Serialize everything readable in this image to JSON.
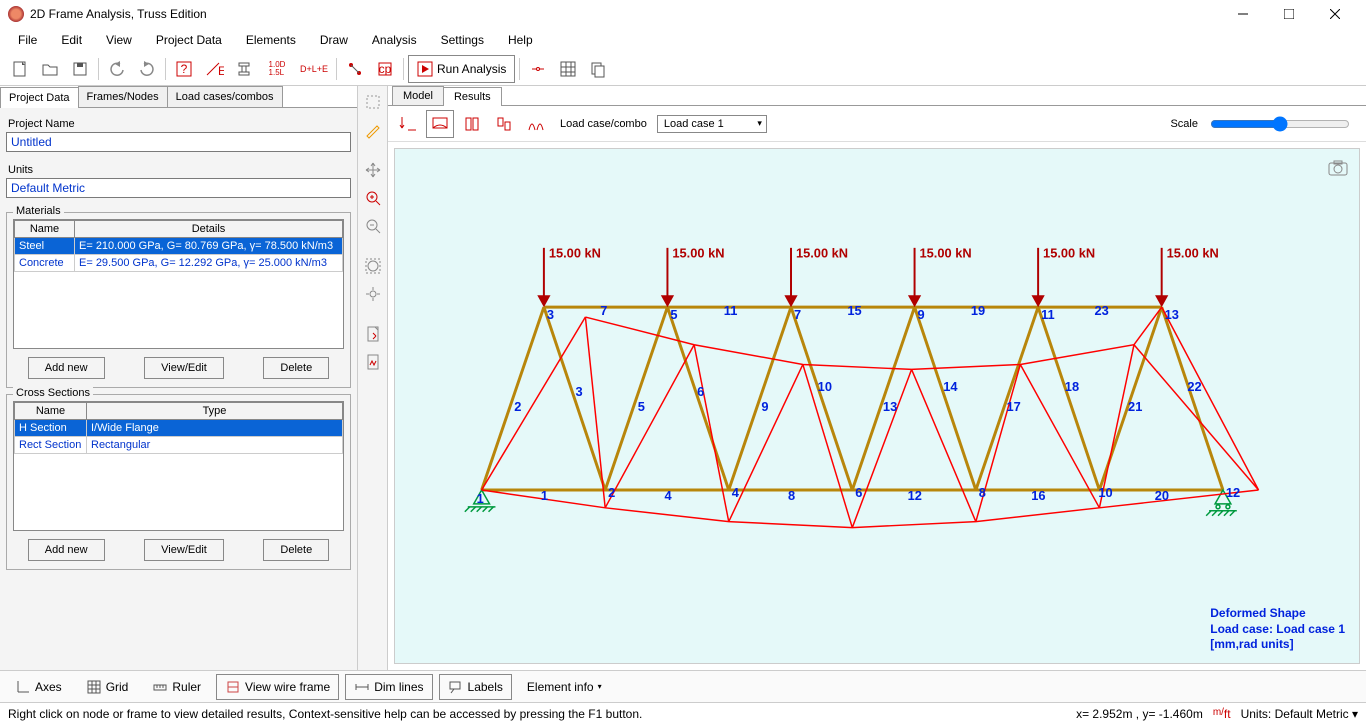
{
  "app": {
    "title": "2D Frame Analysis, Truss Edition"
  },
  "menu": {
    "items": [
      "File",
      "Edit",
      "View",
      "Project Data",
      "Elements",
      "Draw",
      "Analysis",
      "Settings",
      "Help"
    ]
  },
  "toolbar": {
    "run_label": "Run Analysis",
    "txt1": "1.0D\n1.5L",
    "txt2": "D+L+E"
  },
  "left_tabs": {
    "items": [
      "Project Data",
      "Frames/Nodes",
      "Load cases/combos"
    ],
    "active": 0
  },
  "project": {
    "name_label": "Project Name",
    "name_value": "Untitled",
    "units_label": "Units",
    "units_value": "Default Metric"
  },
  "materials": {
    "title": "Materials",
    "headers": [
      "Name",
      "Details"
    ],
    "rows": [
      {
        "name": "Steel",
        "details": "E= 210.000 GPa, G= 80.769 GPa, γ= 78.500 kN/m3",
        "sel": true
      },
      {
        "name": "Concrete",
        "details": "E= 29.500 GPa, G= 12.292 GPa, γ= 25.000 kN/m3",
        "sel": false
      }
    ]
  },
  "sections": {
    "title": "Cross Sections",
    "headers": [
      "Name",
      "Type"
    ],
    "rows": [
      {
        "name": "H Section",
        "type": "I/Wide Flange",
        "sel": true
      },
      {
        "name": "Rect Section",
        "type": "Rectangular",
        "sel": false
      }
    ]
  },
  "buttons": {
    "add": "Add new",
    "edit": "View/Edit",
    "del": "Delete"
  },
  "right_tabs": {
    "items": [
      "Model",
      "Results"
    ],
    "active": 1
  },
  "results_bar": {
    "lc_label": "Load case/combo",
    "lc_value": "Load case 1",
    "scale_label": "Scale"
  },
  "canvas": {
    "loads": [
      "15.00 kN",
      "15.00 kN",
      "15.00 kN",
      "15.00 kN",
      "15.00 kN",
      "15.00 kN"
    ],
    "def_title": "Deformed Shape",
    "def_case": "Load case: Load case 1",
    "def_units": "[mm,rad units]",
    "member_labels": [
      "1",
      "2",
      "3",
      "4",
      "5",
      "6",
      "7",
      "8",
      "9",
      "10",
      "11",
      "12",
      "13",
      "14",
      "15",
      "16",
      "17",
      "18",
      "19",
      "20",
      "21",
      "22",
      "23"
    ],
    "node_labels": [
      "1",
      "2",
      "3",
      "4",
      "5",
      "6",
      "7",
      "8",
      "9",
      "10",
      "11",
      "12",
      "13"
    ]
  },
  "bottom": {
    "axes": "Axes",
    "grid": "Grid",
    "ruler": "Ruler",
    "wire": "View wire frame",
    "dim": "Dim lines",
    "labels": "Labels",
    "elinfo": "Element info"
  },
  "status": {
    "left": "Right click on node or frame to view detailed results, Context-sensitive help can be accessed by pressing the F1 button.",
    "coords": "x= 2.952m , y= -1.460m",
    "units_pre": "Units: ",
    "units_val": "Default Metric"
  }
}
